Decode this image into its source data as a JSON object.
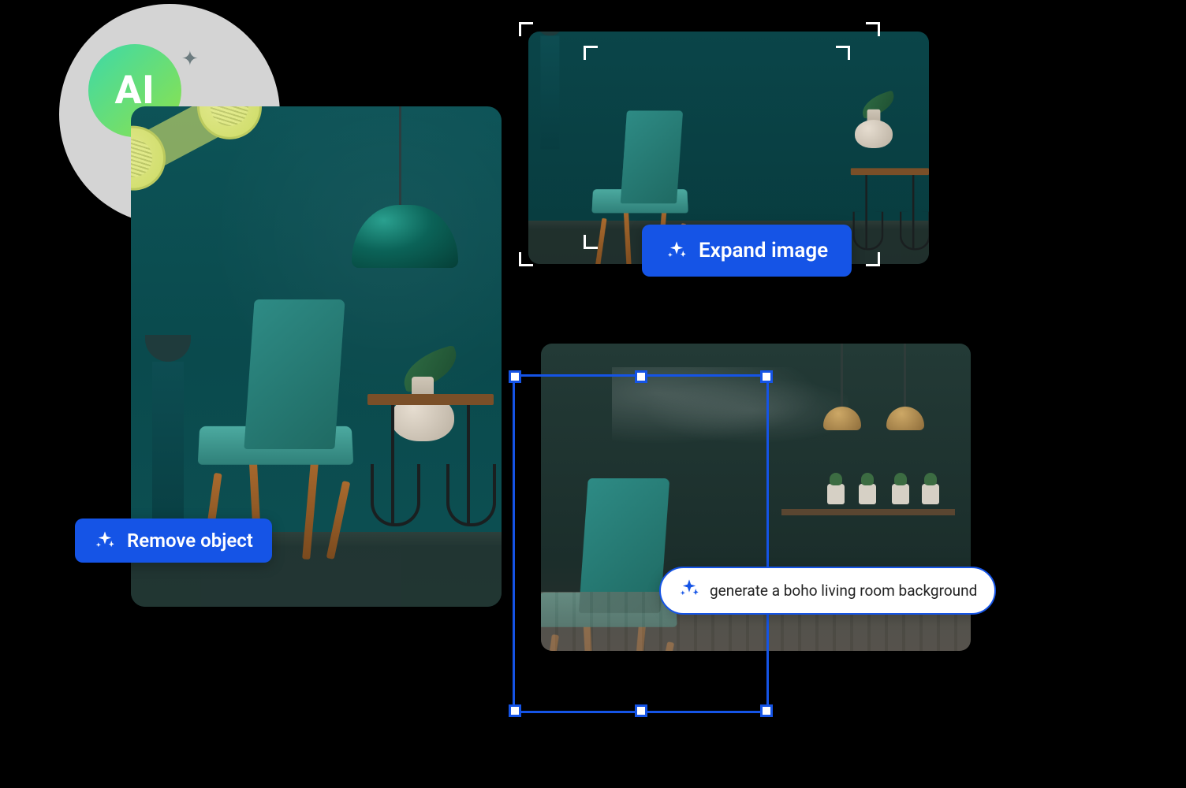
{
  "ai_badge": {
    "label": "AI"
  },
  "actions": {
    "remove_label": "Remove object",
    "expand_label": "Expand image"
  },
  "prompt": {
    "text": "generate a boho living room background"
  }
}
